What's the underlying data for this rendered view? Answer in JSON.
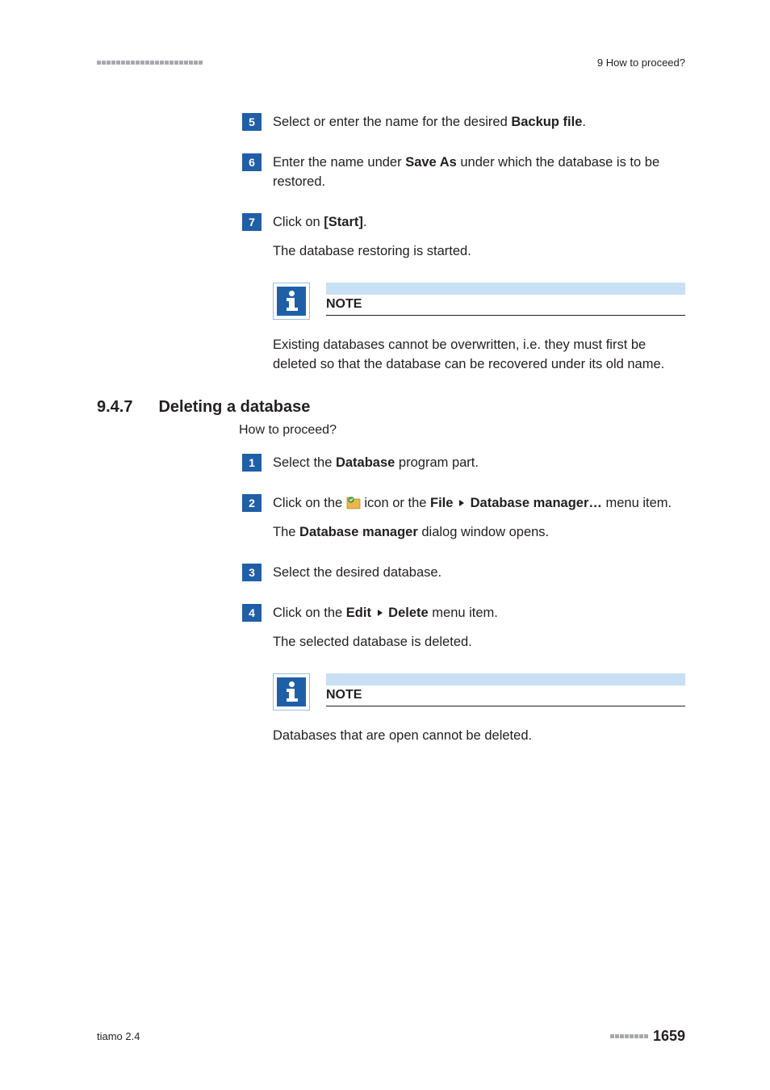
{
  "header": {
    "right": "9 How to proceed?"
  },
  "steps_a": [
    {
      "num": "5",
      "parts": [
        {
          "t": "Select or enter the name for the desired "
        },
        {
          "t": "Backup file",
          "b": true
        },
        {
          "t": "."
        }
      ]
    },
    {
      "num": "6",
      "parts": [
        {
          "t": "Enter the name under "
        },
        {
          "t": "Save As",
          "b": true
        },
        {
          "t": " under which the database is to be restored."
        }
      ]
    },
    {
      "num": "7",
      "parts": [
        {
          "t": "Click on "
        },
        {
          "t": "[Start]",
          "b": true
        },
        {
          "t": "."
        }
      ],
      "after": "The database restoring is started."
    }
  ],
  "note1": {
    "title": "NOTE",
    "text": "Existing databases cannot be overwritten, i.e. they must first be deleted so that the database can be recovered under its old name."
  },
  "section": {
    "num": "9.4.7",
    "title": "Deleting a database",
    "howto": "How to proceed?"
  },
  "steps_b": [
    {
      "num": "1",
      "parts": [
        {
          "t": "Select the "
        },
        {
          "t": "Database",
          "b": true
        },
        {
          "t": " program part."
        }
      ]
    },
    {
      "num": "2",
      "parts": [
        {
          "t": "Click on the "
        },
        {
          "t": "ICON"
        },
        {
          "t": " icon or the "
        },
        {
          "t": "File",
          "b": true
        },
        {
          "t": "TRI"
        },
        {
          "t": "Database manager…",
          "b": true
        },
        {
          "t": " menu item."
        }
      ],
      "after": "The Database manager dialog window opens.",
      "after_parts": [
        {
          "t": "The "
        },
        {
          "t": "Database manager",
          "b": true
        },
        {
          "t": " dialog window opens."
        }
      ]
    },
    {
      "num": "3",
      "parts": [
        {
          "t": "Select the desired database."
        }
      ]
    },
    {
      "num": "4",
      "parts": [
        {
          "t": "Click on the "
        },
        {
          "t": "Edit",
          "b": true
        },
        {
          "t": "TRI"
        },
        {
          "t": "Delete",
          "b": true
        },
        {
          "t": " menu item."
        }
      ],
      "after": "The selected database is deleted."
    }
  ],
  "note2": {
    "title": "NOTE",
    "text": "Databases that are open cannot be deleted."
  },
  "footer": {
    "left": "tiamo 2.4",
    "page": "1659"
  }
}
